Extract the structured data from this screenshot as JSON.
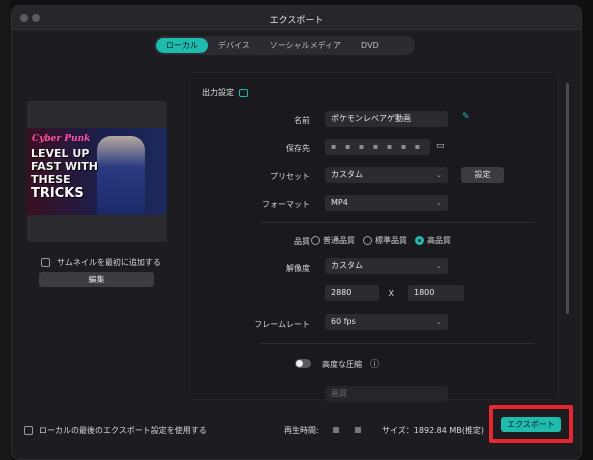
{
  "window": {
    "title": "エクスポート"
  },
  "tabs": [
    {
      "label": "ローカル",
      "active": true
    },
    {
      "label": "デバイス",
      "active": false
    },
    {
      "label": "ソーシャルメディア",
      "active": false
    },
    {
      "label": "DVD",
      "active": false
    }
  ],
  "preview": {
    "line1": "Cyber Punk",
    "line2": "LEVEL UP FAST WITH THESE",
    "line3": "TRICKS",
    "add_thumbnail_label": "サムネイルを最初に追加する",
    "edit_label": "編集"
  },
  "settings": {
    "section_title": "出力設定",
    "name_label": "名前",
    "name_value": "ポケモンレベアゲ動画",
    "save_to_label": "保存先",
    "preset_label": "プリセット",
    "preset_value": "カスタム",
    "preset_settings_button": "設定",
    "format_label": "フォーマット",
    "format_value": "MP4",
    "quality_label": "品質",
    "quality_options": [
      {
        "label": "普通品質",
        "selected": false
      },
      {
        "label": "標準品質",
        "selected": false
      },
      {
        "label": "高品質",
        "selected": true
      }
    ],
    "resolution_label": "解像度",
    "resolution_value": "カスタム",
    "width_value": "2880",
    "x_label": "X",
    "height_value": "1800",
    "framerate_label": "フレームレート",
    "framerate_value": "60 fps",
    "compression_label": "高度な圧縮",
    "compression_quality_value": "画質"
  },
  "footer": {
    "use_last_settings_label": "ローカルの最後のエクスポート設定を使用する",
    "duration_label": "再生時間:",
    "size_label": "サイズ：1892.84 MB(推定)",
    "export_button": "エクスポート"
  },
  "colors": {
    "accent": "#1ebbae",
    "highlight": "#e8262f"
  }
}
